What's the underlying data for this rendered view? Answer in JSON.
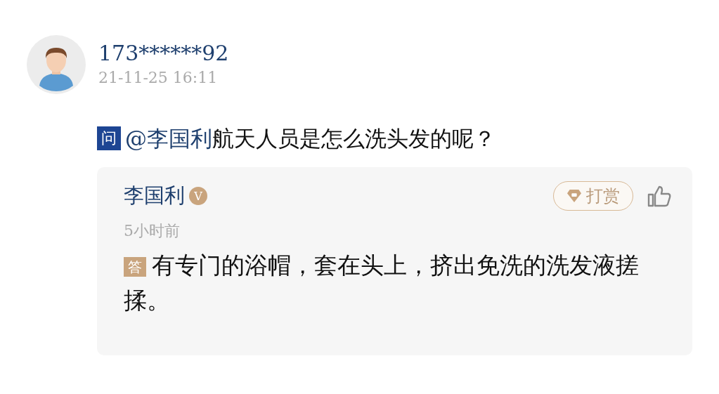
{
  "question": {
    "user": "173******92",
    "time": "21-11-25 16:11",
    "tag": "问",
    "mention": "@李国利",
    "text": "航天人员是怎么洗头发的呢？"
  },
  "answer": {
    "author": "李国利",
    "verified": true,
    "badge": "V",
    "tip_button": "打赏",
    "time": "5小时前",
    "tag": "答",
    "text": "有专门的浴帽，套在头上，挤出免洗的洗发液搓揉。"
  }
}
